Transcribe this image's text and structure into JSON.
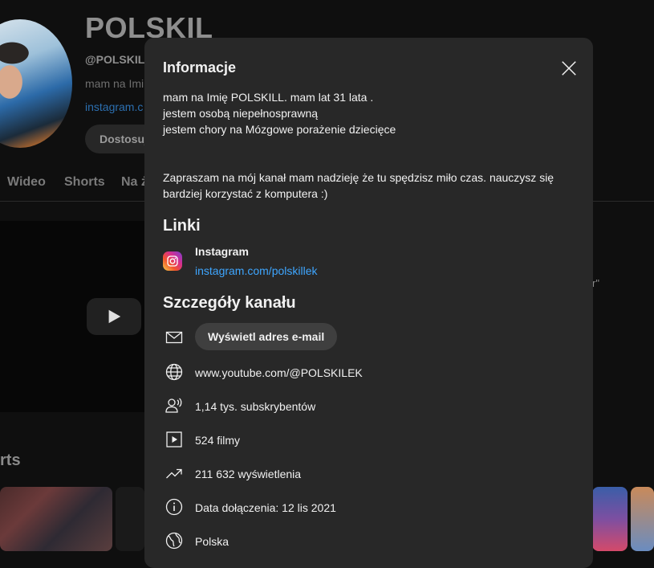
{
  "channel": {
    "name": "POLSKIL",
    "handle": "@POLSKILE",
    "description_snippet": "mam na Imi",
    "link_snippet": "instagram.c",
    "customize_label": "Dostosuj"
  },
  "tabs": [
    {
      "label": "Wideo"
    },
    {
      "label": "Shorts"
    },
    {
      "label": "Na ż"
    }
  ],
  "background": {
    "shorts_heading": "rts",
    "quote_fragment": "r\""
  },
  "modal": {
    "title": "Informacje",
    "description": [
      "mam na Imię POLSKILL. mam lat 31 lata .",
      " jestem osobą niepełnosprawną",
      "jestem chory na Mózgowe porażenie dziecięce",
      "Zapraszam na mój kanał mam nadzieję że tu spędzisz miło czas. nauczysz się bardziej korzystać z komputera :)"
    ],
    "links_heading": "Linki",
    "links": [
      {
        "name": "Instagram",
        "url": "instagram.com/polskillek",
        "icon": "instagram-icon"
      }
    ],
    "details_heading": "Szczegóły kanału",
    "details": {
      "email_button": "Wyświetl adres e-mail",
      "url": "www.youtube.com/@POLSKILEK",
      "subscribers": "1,14 tys. subskrybentów",
      "videos": "524 filmy",
      "views": "211 632 wyświetlenia",
      "joined": "Data dołączenia: 12 lis 2021",
      "country": "Polska"
    }
  },
  "colors": {
    "page_bg": "#0f0f0f",
    "modal_bg": "#282828",
    "link": "#3ea6ff",
    "button_bg": "#3f3f3f"
  }
}
